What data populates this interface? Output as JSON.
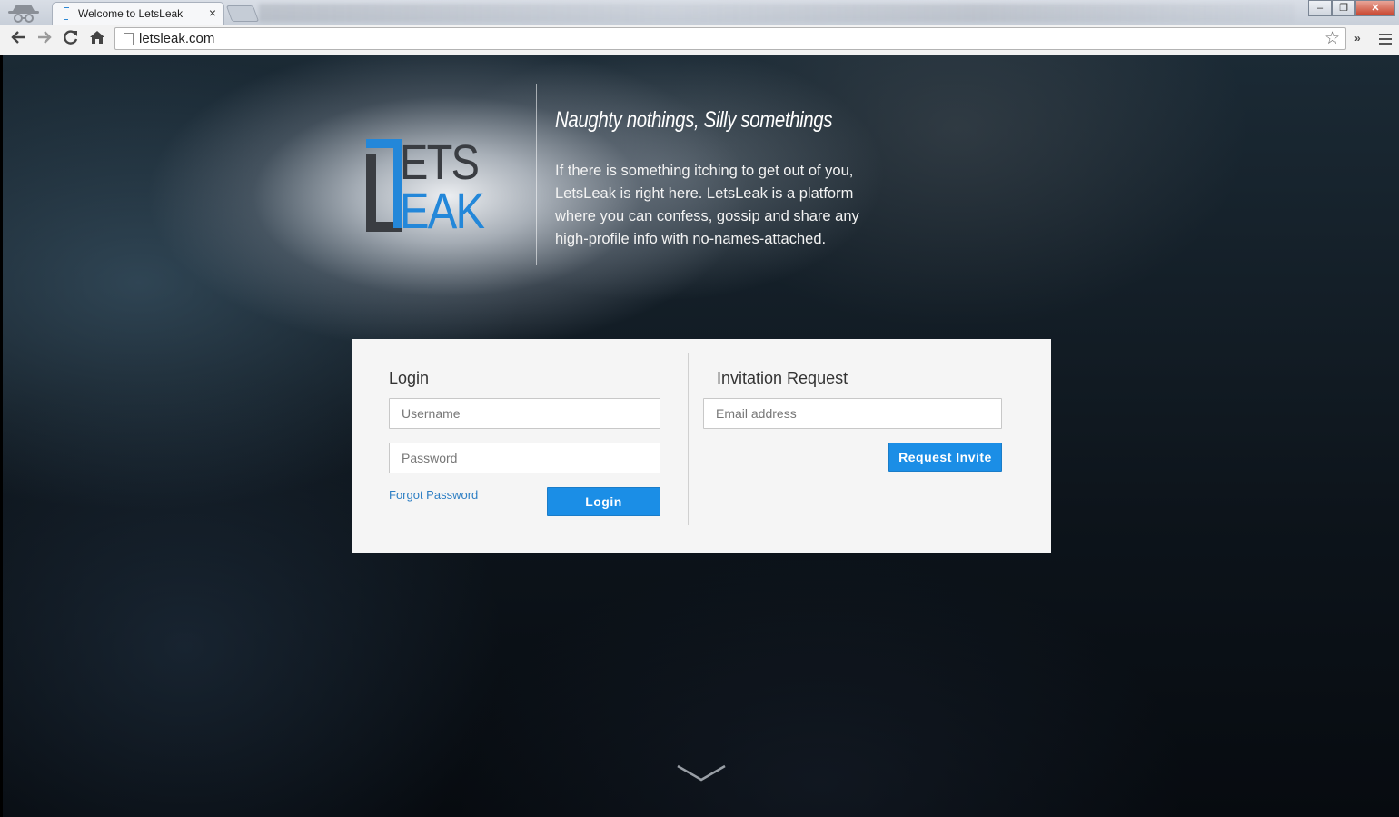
{
  "browser": {
    "tab_title": "Welcome to LetsLeak",
    "tab_close": "×",
    "url": "letsleak.com",
    "more_label": "»",
    "window_controls": {
      "minimize": "–",
      "restore": "❐",
      "close": "✕"
    }
  },
  "hero": {
    "logo_top": "ETS",
    "logo_bottom": "EAK",
    "tagline": "Naughty nothings, Silly somethings",
    "description": "If there is something itching to get out of you, LetsLeak is right here. LetsLeak is a platform where you can confess, gossip and share any high-profile info with no-names-attached."
  },
  "login": {
    "title": "Login",
    "username_placeholder": "Username",
    "password_placeholder": "Password",
    "forgot_label": "Forgot Password",
    "button_label": "Login"
  },
  "invite": {
    "title": "Invitation Request",
    "email_placeholder": "Email address",
    "button_label": "Request Invite"
  },
  "colors": {
    "accent": "#1b8ee6",
    "logo_dark": "#3a3d42",
    "logo_blue": "#2387d9"
  }
}
